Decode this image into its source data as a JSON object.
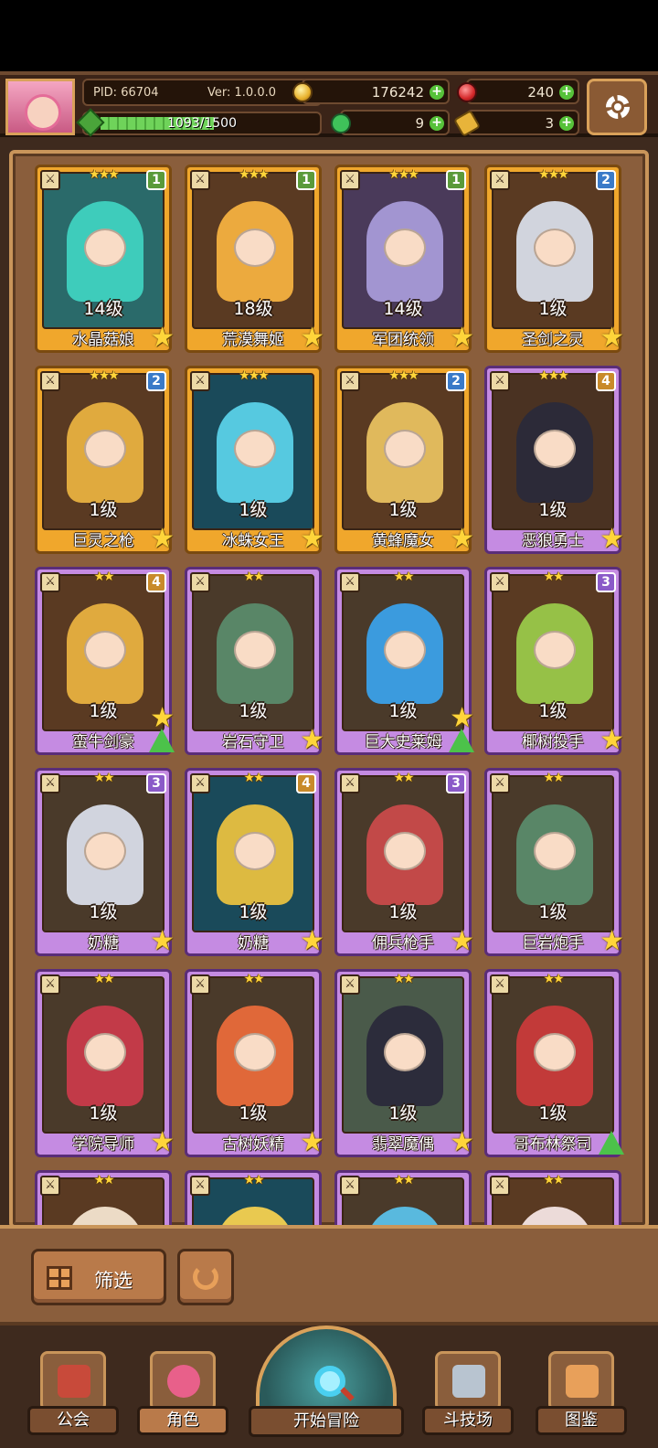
{
  "header": {
    "pid": "PID: 66704",
    "version": "Ver: 1.0.0.0",
    "exp": "1093/1500",
    "exp_progress": 0.7287,
    "gold": "176242",
    "gems": "240",
    "clovers": "9",
    "keys": "3"
  },
  "cards": [
    {
      "level": "14级",
      "name": "水晶菇娘",
      "badge": "1",
      "badge_color": "green",
      "frame": "gold",
      "stars": "★★★",
      "art_bg": "#2a6a6a",
      "char_color": "#3fd2c0",
      "extra": "star"
    },
    {
      "level": "18级",
      "name": "荒漠舞姬",
      "badge": "1",
      "badge_color": "green",
      "frame": "gold",
      "stars": "★★★",
      "art_bg": "#5a3a22",
      "char_color": "#f4b040",
      "extra": "star"
    },
    {
      "level": "14级",
      "name": "军团统领",
      "badge": "1",
      "badge_color": "green",
      "frame": "gold",
      "stars": "★★★",
      "art_bg": "#4a3a5a",
      "char_color": "#a69ad8",
      "extra": "star"
    },
    {
      "level": "1级",
      "name": "圣剑之灵",
      "badge": "2",
      "badge_color": "blue",
      "frame": "gold",
      "stars": "★★★",
      "art_bg": "#5a3a22",
      "char_color": "#d8dce8",
      "extra": "star"
    },
    {
      "level": "1级",
      "name": "巨灵之枪",
      "badge": "2",
      "badge_color": "blue",
      "frame": "gold",
      "stars": "★★★",
      "art_bg": "#5a3a22",
      "char_color": "#e8b040",
      "extra": "star"
    },
    {
      "level": "1级",
      "name": "冰蛛女王",
      "badge": "",
      "badge_color": "",
      "frame": "gold",
      "stars": "★★★",
      "art_bg": "#1a4a5a",
      "char_color": "#5ad0e8",
      "extra": "star"
    },
    {
      "level": "1级",
      "name": "黄蜂魔女",
      "badge": "2",
      "badge_color": "blue",
      "frame": "gold",
      "stars": "★★★",
      "art_bg": "#5a3a22",
      "char_color": "#e8c060",
      "extra": "star"
    },
    {
      "level": "1级",
      "name": "恶狼勇士",
      "badge": "4",
      "badge_color": "orange",
      "frame": "purple",
      "stars": "★★★",
      "art_bg": "#4a3222",
      "char_color": "#2a2a3a",
      "extra": "star"
    },
    {
      "level": "1级",
      "name": "蛮牛剑豪",
      "badge": "4",
      "badge_color": "orange",
      "frame": "purple",
      "stars": "★★",
      "art_bg": "#5a3a22",
      "char_color": "#e8b040",
      "extra": "star-up"
    },
    {
      "level": "1级",
      "name": "岩石守卫",
      "badge": "",
      "badge_color": "",
      "frame": "purple",
      "stars": "★★",
      "art_bg": "#4a3a2a",
      "char_color": "#5a8a6a",
      "extra": "star"
    },
    {
      "level": "1级",
      "name": "巨大史莱姆",
      "badge": "",
      "badge_color": "",
      "frame": "purple",
      "stars": "★★",
      "art_bg": "#4a3a2a",
      "char_color": "#3aa0e8",
      "extra": "star-up"
    },
    {
      "level": "1级",
      "name": "椰树投手",
      "badge": "3",
      "badge_color": "violet",
      "frame": "purple",
      "stars": "★★",
      "art_bg": "#5a3a22",
      "char_color": "#9ac84a",
      "extra": "star"
    },
    {
      "level": "1级",
      "name": "奶糖",
      "badge": "3",
      "badge_color": "violet",
      "frame": "purple",
      "stars": "★★",
      "art_bg": "#4a3a2a",
      "char_color": "#d8dce8",
      "extra": "star"
    },
    {
      "level": "1级",
      "name": "奶糖",
      "badge": "4",
      "badge_color": "orange",
      "frame": "purple",
      "stars": "★★",
      "art_bg": "#1a4a5a",
      "char_color": "#e8c040",
      "extra": "star"
    },
    {
      "level": "1级",
      "name": "佣兵枪手",
      "badge": "3",
      "badge_color": "violet",
      "frame": "purple",
      "stars": "★★",
      "art_bg": "#4a3a2a",
      "char_color": "#c84a4a",
      "extra": "star"
    },
    {
      "level": "1级",
      "name": "巨岩炮手",
      "badge": "",
      "badge_color": "",
      "frame": "purple",
      "stars": "★★",
      "art_bg": "#4a3a2a",
      "char_color": "#5a8a6a",
      "extra": "star"
    },
    {
      "level": "1级",
      "name": "学院导师",
      "badge": "",
      "badge_color": "",
      "frame": "purple",
      "stars": "★★",
      "art_bg": "#4a3a2a",
      "char_color": "#c83a4a",
      "extra": "star"
    },
    {
      "level": "1级",
      "name": "古树妖精",
      "badge": "",
      "badge_color": "",
      "frame": "purple",
      "stars": "★★",
      "art_bg": "#4a3a2a",
      "char_color": "#e86a3a",
      "extra": "star"
    },
    {
      "level": "1级",
      "name": "翡翠魔偶",
      "badge": "",
      "badge_color": "",
      "frame": "purple",
      "stars": "★★",
      "art_bg": "#4a5a4a",
      "char_color": "#2a2a3a",
      "extra": "star"
    },
    {
      "level": "1级",
      "name": "哥布林祭司",
      "badge": "",
      "badge_color": "",
      "frame": "purple",
      "stars": "★★",
      "art_bg": "#4a3a2a",
      "char_color": "#c83a3a",
      "extra": "up"
    },
    {
      "level": "",
      "name": "",
      "badge": "",
      "badge_color": "",
      "frame": "purple",
      "stars": "★★",
      "art_bg": "#5a3a22",
      "char_color": "#f4e4d0",
      "extra": ""
    },
    {
      "level": "",
      "name": "",
      "badge": "",
      "badge_color": "",
      "frame": "purple",
      "stars": "★★",
      "art_bg": "#1a4a5a",
      "char_color": "#f4d050",
      "extra": ""
    },
    {
      "level": "",
      "name": "",
      "badge": "",
      "badge_color": "",
      "frame": "purple",
      "stars": "★★",
      "art_bg": "#4a3a2a",
      "char_color": "#5ac0e8",
      "extra": ""
    },
    {
      "level": "",
      "name": "",
      "badge": "",
      "badge_color": "",
      "frame": "purple",
      "stars": "★★",
      "art_bg": "#5a3a22",
      "char_color": "#f4e4e4",
      "extra": ""
    }
  ],
  "filter": {
    "label": "筛选"
  },
  "nav": {
    "guild": "公会",
    "character": "角色",
    "adventure": "开始冒险",
    "arena": "斗技场",
    "codex": "图鉴"
  }
}
